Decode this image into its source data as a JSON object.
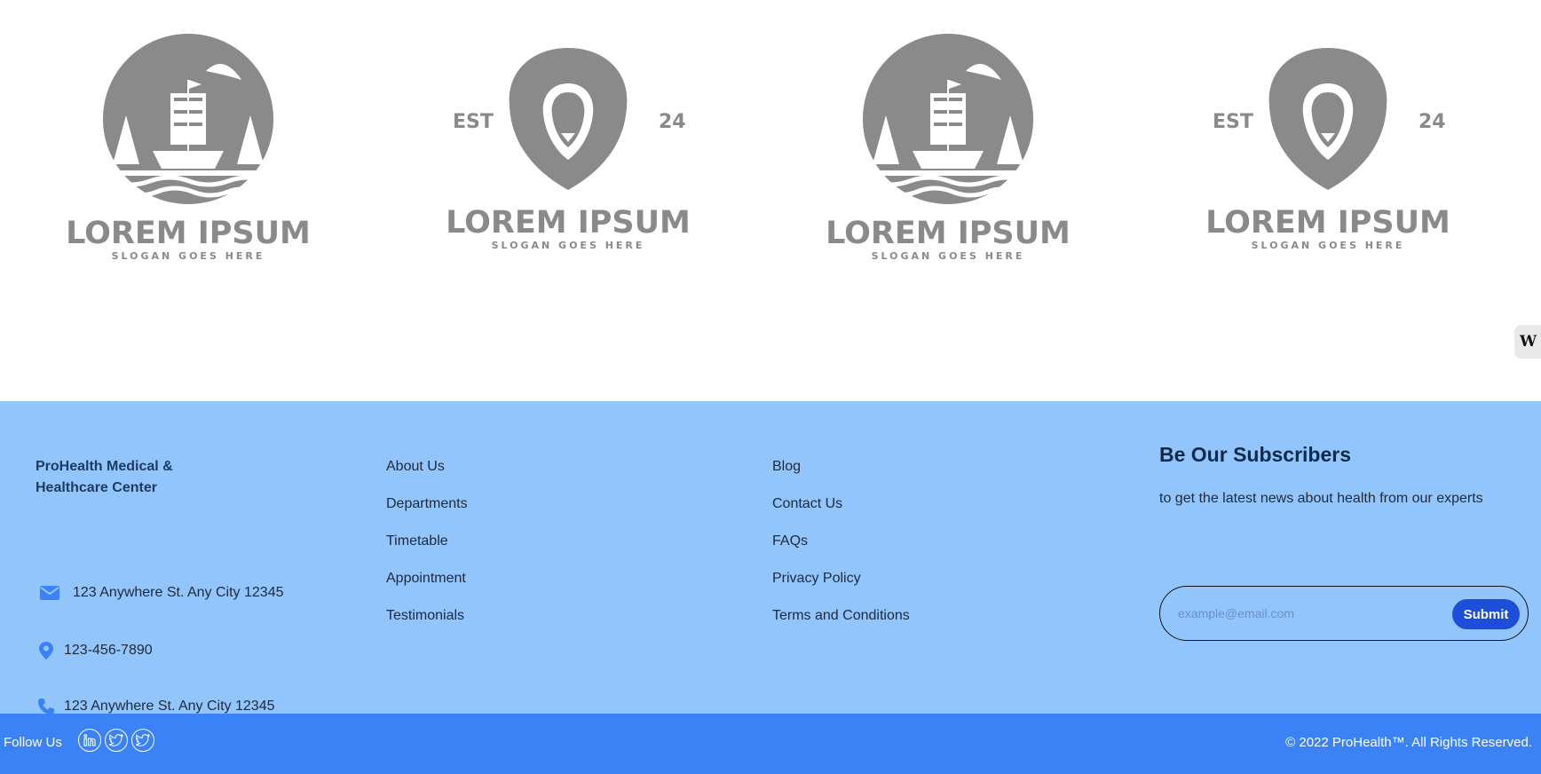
{
  "logos": [
    {
      "name": "LOREM IPSUM",
      "slogan": "SLOGAN GOES HERE",
      "icon": "ship-icon"
    },
    {
      "name": "LOREM IPSUM",
      "slogan": "SLOGAN GOES HERE",
      "icon": "lion-icon",
      "est": "EST",
      "year": "24"
    },
    {
      "name": "LOREM IPSUM",
      "slogan": "SLOGAN GOES HERE",
      "icon": "ship-icon"
    },
    {
      "name": "LOREM IPSUM",
      "slogan": "SLOGAN GOES HERE",
      "icon": "lion-icon",
      "est": "EST",
      "year": "24"
    }
  ],
  "side_widget": {
    "label": "W"
  },
  "footer": {
    "brand": "ProHealth Medical & Healthcare Center",
    "contacts": {
      "email": "123 Anywhere St. Any City 12345",
      "phone": "123-456-7890",
      "address": "123 Anywhere St. Any City 12345"
    },
    "links_1": [
      "About Us",
      "Departments",
      "Timetable",
      "Appointment",
      "Testimonials"
    ],
    "links_2": [
      "Blog",
      "Contact Us",
      "FAQs",
      "Privacy Policy",
      "Terms and Conditions"
    ],
    "subscribe": {
      "title": "Be Our Subscribers",
      "text": "to get the latest news about health from our experts",
      "placeholder": "example@email.com",
      "button": "Submit"
    }
  },
  "bottom": {
    "follow": "Follow Us",
    "socials": [
      "linkedin-icon",
      "twitter-icon",
      "twitter-icon"
    ],
    "copyright": "© 2022 ProHealth™. All Rights Reserved."
  },
  "colors": {
    "footer_bg": "#93c5fd",
    "bottom_bg": "#3b82f6",
    "button_bg": "#1d4ed8",
    "logo_gray": "#8a8a8a"
  }
}
